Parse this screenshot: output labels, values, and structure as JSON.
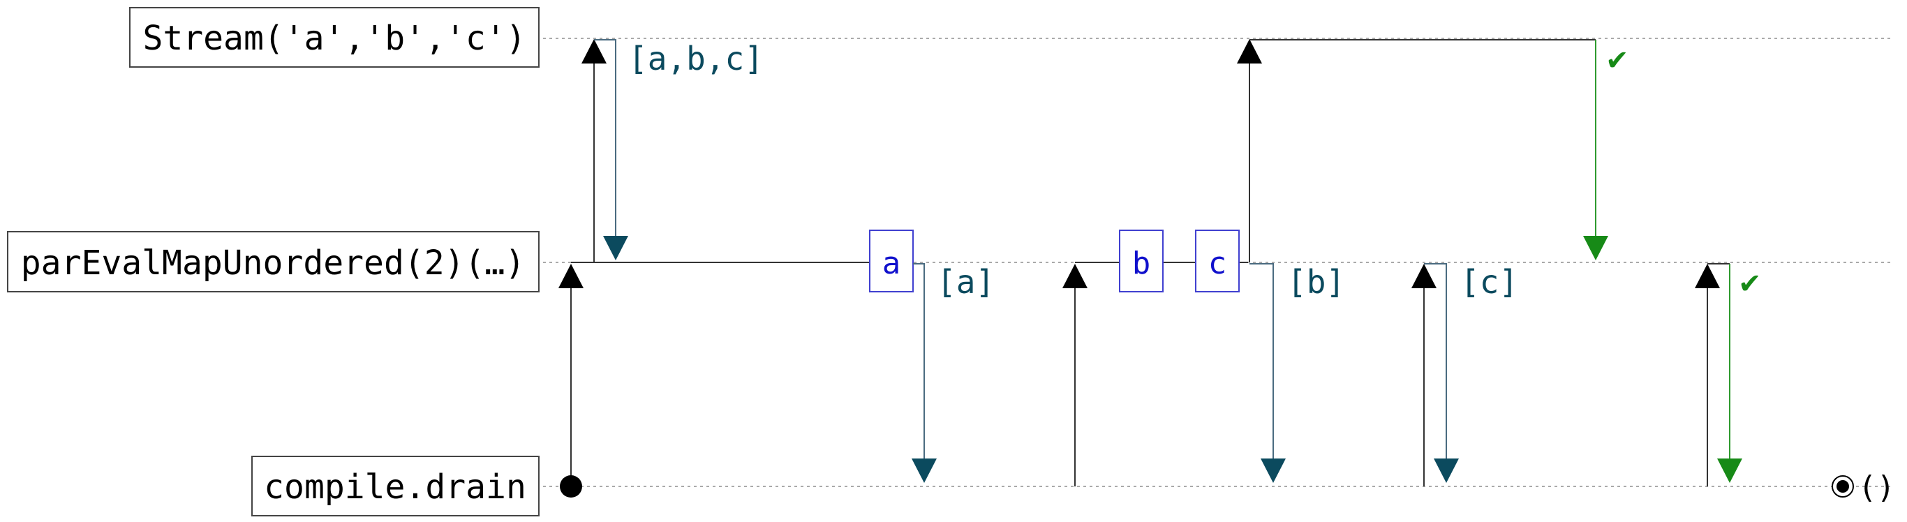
{
  "lanes": [
    {
      "id": "stream",
      "label": "Stream('a','b','c')"
    },
    {
      "id": "pareval",
      "label": "parEvalMapUnordered(2)(…)"
    },
    {
      "id": "drain",
      "label": "compile.drain"
    }
  ],
  "chunks": [
    {
      "id": "chunk-abc",
      "label": "[a,b,c]"
    },
    {
      "id": "chunk-a",
      "label": "[a]"
    },
    {
      "id": "chunk-b",
      "label": "[b]"
    },
    {
      "id": "chunk-c",
      "label": "[c]"
    }
  ],
  "elements": [
    {
      "id": "elem-a",
      "label": "a"
    },
    {
      "id": "elem-b",
      "label": "b"
    },
    {
      "id": "elem-c",
      "label": "c"
    }
  ],
  "done_marks": [
    {
      "id": "done-stream",
      "label": "✔"
    },
    {
      "id": "done-pareval",
      "label": "✔"
    }
  ],
  "result": {
    "label": "()"
  },
  "colors": {
    "pull": "#000000",
    "emit": "#0b4a5e",
    "done": "#178a17",
    "element": "#1010cc"
  }
}
